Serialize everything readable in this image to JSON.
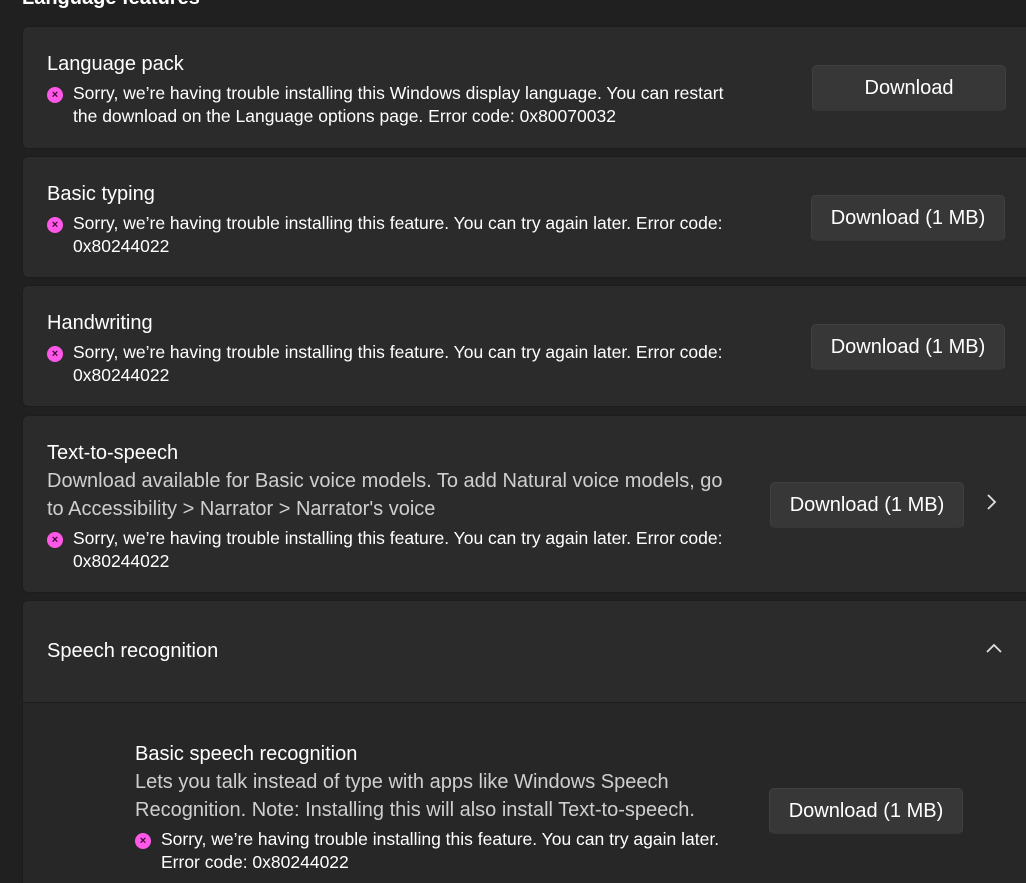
{
  "section_title": "Language features",
  "error_icon": "error-x-icon",
  "colors": {
    "error": "#ff57e8",
    "card": "#2b2b2b",
    "button": "#373737"
  },
  "features": {
    "language_pack": {
      "title": "Language pack",
      "error": "Sorry, we’re having trouble installing this Windows display language. You can restart the download on the Language options page. Error code: 0x80070032",
      "button": "Download"
    },
    "basic_typing": {
      "title": "Basic typing",
      "error": "Sorry, we’re having trouble installing this feature. You can try again later. Error code: 0x80244022",
      "button": "Download (1 MB)"
    },
    "handwriting": {
      "title": "Handwriting",
      "error": "Sorry, we’re having trouble installing this feature. You can try again later. Error code: 0x80244022",
      "button": "Download (1 MB)"
    },
    "tts": {
      "title": "Text-to-speech",
      "description": "Download available for Basic voice models. To add Natural voice models, go to Accessibility > Narrator > Narrator's voice",
      "error": "Sorry, we’re having trouble installing this feature. You can try again later. Error code: 0x80244022",
      "button": "Download (1 MB)",
      "chevron": "›"
    },
    "speech_recognition": {
      "title": "Speech recognition",
      "chevron": "^",
      "basic": {
        "title": "Basic speech recognition",
        "description": "Lets you talk instead of type with apps like Windows Speech Recognition. Note: Installing this will also install Text-to-speech.",
        "error": "Sorry, we’re having trouble installing this feature. You can try again later. Error code: 0x80244022",
        "button": "Download (1 MB)"
      }
    }
  }
}
